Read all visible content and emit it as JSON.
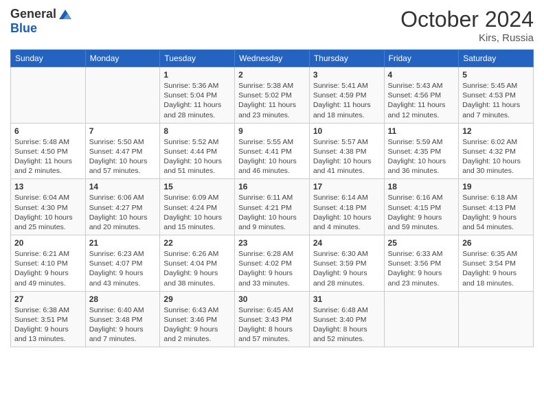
{
  "header": {
    "logo_line1": "General",
    "logo_line2": "Blue",
    "month": "October 2024",
    "location": "Kirs, Russia"
  },
  "weekdays": [
    "Sunday",
    "Monday",
    "Tuesday",
    "Wednesday",
    "Thursday",
    "Friday",
    "Saturday"
  ],
  "weeks": [
    [
      {
        "day": "",
        "sunrise": "",
        "sunset": "",
        "daylight": ""
      },
      {
        "day": "",
        "sunrise": "",
        "sunset": "",
        "daylight": ""
      },
      {
        "day": "1",
        "sunrise": "Sunrise: 5:36 AM",
        "sunset": "Sunset: 5:04 PM",
        "daylight": "Daylight: 11 hours and 28 minutes."
      },
      {
        "day": "2",
        "sunrise": "Sunrise: 5:38 AM",
        "sunset": "Sunset: 5:02 PM",
        "daylight": "Daylight: 11 hours and 23 minutes."
      },
      {
        "day": "3",
        "sunrise": "Sunrise: 5:41 AM",
        "sunset": "Sunset: 4:59 PM",
        "daylight": "Daylight: 11 hours and 18 minutes."
      },
      {
        "day": "4",
        "sunrise": "Sunrise: 5:43 AM",
        "sunset": "Sunset: 4:56 PM",
        "daylight": "Daylight: 11 hours and 12 minutes."
      },
      {
        "day": "5",
        "sunrise": "Sunrise: 5:45 AM",
        "sunset": "Sunset: 4:53 PM",
        "daylight": "Daylight: 11 hours and 7 minutes."
      }
    ],
    [
      {
        "day": "6",
        "sunrise": "Sunrise: 5:48 AM",
        "sunset": "Sunset: 4:50 PM",
        "daylight": "Daylight: 11 hours and 2 minutes."
      },
      {
        "day": "7",
        "sunrise": "Sunrise: 5:50 AM",
        "sunset": "Sunset: 4:47 PM",
        "daylight": "Daylight: 10 hours and 57 minutes."
      },
      {
        "day": "8",
        "sunrise": "Sunrise: 5:52 AM",
        "sunset": "Sunset: 4:44 PM",
        "daylight": "Daylight: 10 hours and 51 minutes."
      },
      {
        "day": "9",
        "sunrise": "Sunrise: 5:55 AM",
        "sunset": "Sunset: 4:41 PM",
        "daylight": "Daylight: 10 hours and 46 minutes."
      },
      {
        "day": "10",
        "sunrise": "Sunrise: 5:57 AM",
        "sunset": "Sunset: 4:38 PM",
        "daylight": "Daylight: 10 hours and 41 minutes."
      },
      {
        "day": "11",
        "sunrise": "Sunrise: 5:59 AM",
        "sunset": "Sunset: 4:35 PM",
        "daylight": "Daylight: 10 hours and 36 minutes."
      },
      {
        "day": "12",
        "sunrise": "Sunrise: 6:02 AM",
        "sunset": "Sunset: 4:32 PM",
        "daylight": "Daylight: 10 hours and 30 minutes."
      }
    ],
    [
      {
        "day": "13",
        "sunrise": "Sunrise: 6:04 AM",
        "sunset": "Sunset: 4:30 PM",
        "daylight": "Daylight: 10 hours and 25 minutes."
      },
      {
        "day": "14",
        "sunrise": "Sunrise: 6:06 AM",
        "sunset": "Sunset: 4:27 PM",
        "daylight": "Daylight: 10 hours and 20 minutes."
      },
      {
        "day": "15",
        "sunrise": "Sunrise: 6:09 AM",
        "sunset": "Sunset: 4:24 PM",
        "daylight": "Daylight: 10 hours and 15 minutes."
      },
      {
        "day": "16",
        "sunrise": "Sunrise: 6:11 AM",
        "sunset": "Sunset: 4:21 PM",
        "daylight": "Daylight: 10 hours and 9 minutes."
      },
      {
        "day": "17",
        "sunrise": "Sunrise: 6:14 AM",
        "sunset": "Sunset: 4:18 PM",
        "daylight": "Daylight: 10 hours and 4 minutes."
      },
      {
        "day": "18",
        "sunrise": "Sunrise: 6:16 AM",
        "sunset": "Sunset: 4:15 PM",
        "daylight": "Daylight: 9 hours and 59 minutes."
      },
      {
        "day": "19",
        "sunrise": "Sunrise: 6:18 AM",
        "sunset": "Sunset: 4:13 PM",
        "daylight": "Daylight: 9 hours and 54 minutes."
      }
    ],
    [
      {
        "day": "20",
        "sunrise": "Sunrise: 6:21 AM",
        "sunset": "Sunset: 4:10 PM",
        "daylight": "Daylight: 9 hours and 49 minutes."
      },
      {
        "day": "21",
        "sunrise": "Sunrise: 6:23 AM",
        "sunset": "Sunset: 4:07 PM",
        "daylight": "Daylight: 9 hours and 43 minutes."
      },
      {
        "day": "22",
        "sunrise": "Sunrise: 6:26 AM",
        "sunset": "Sunset: 4:04 PM",
        "daylight": "Daylight: 9 hours and 38 minutes."
      },
      {
        "day": "23",
        "sunrise": "Sunrise: 6:28 AM",
        "sunset": "Sunset: 4:02 PM",
        "daylight": "Daylight: 9 hours and 33 minutes."
      },
      {
        "day": "24",
        "sunrise": "Sunrise: 6:30 AM",
        "sunset": "Sunset: 3:59 PM",
        "daylight": "Daylight: 9 hours and 28 minutes."
      },
      {
        "day": "25",
        "sunrise": "Sunrise: 6:33 AM",
        "sunset": "Sunset: 3:56 PM",
        "daylight": "Daylight: 9 hours and 23 minutes."
      },
      {
        "day": "26",
        "sunrise": "Sunrise: 6:35 AM",
        "sunset": "Sunset: 3:54 PM",
        "daylight": "Daylight: 9 hours and 18 minutes."
      }
    ],
    [
      {
        "day": "27",
        "sunrise": "Sunrise: 6:38 AM",
        "sunset": "Sunset: 3:51 PM",
        "daylight": "Daylight: 9 hours and 13 minutes."
      },
      {
        "day": "28",
        "sunrise": "Sunrise: 6:40 AM",
        "sunset": "Sunset: 3:48 PM",
        "daylight": "Daylight: 9 hours and 7 minutes."
      },
      {
        "day": "29",
        "sunrise": "Sunrise: 6:43 AM",
        "sunset": "Sunset: 3:46 PM",
        "daylight": "Daylight: 9 hours and 2 minutes."
      },
      {
        "day": "30",
        "sunrise": "Sunrise: 6:45 AM",
        "sunset": "Sunset: 3:43 PM",
        "daylight": "Daylight: 8 hours and 57 minutes."
      },
      {
        "day": "31",
        "sunrise": "Sunrise: 6:48 AM",
        "sunset": "Sunset: 3:40 PM",
        "daylight": "Daylight: 8 hours and 52 minutes."
      },
      {
        "day": "",
        "sunrise": "",
        "sunset": "",
        "daylight": ""
      },
      {
        "day": "",
        "sunrise": "",
        "sunset": "",
        "daylight": ""
      }
    ]
  ]
}
